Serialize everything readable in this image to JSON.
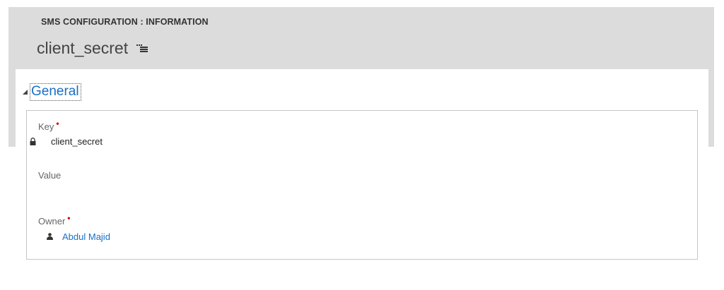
{
  "header": {
    "entity_label": "SMS CONFIGURATION : INFORMATION",
    "record_title": "client_secret"
  },
  "section": {
    "title": "General",
    "collapse_icon": "triangle-collapse-icon"
  },
  "fields": {
    "key": {
      "label": "Key",
      "required": "•",
      "value": "client_secret",
      "icon": "lock-icon"
    },
    "value": {
      "label": "Value",
      "value": ""
    },
    "owner": {
      "label": "Owner",
      "required": "•",
      "value": "Abdul Majid",
      "icon": "user-icon"
    }
  },
  "colors": {
    "header_band": "#dcdcdc",
    "link_blue": "#1a6fc4",
    "required_red": "#e00000"
  }
}
